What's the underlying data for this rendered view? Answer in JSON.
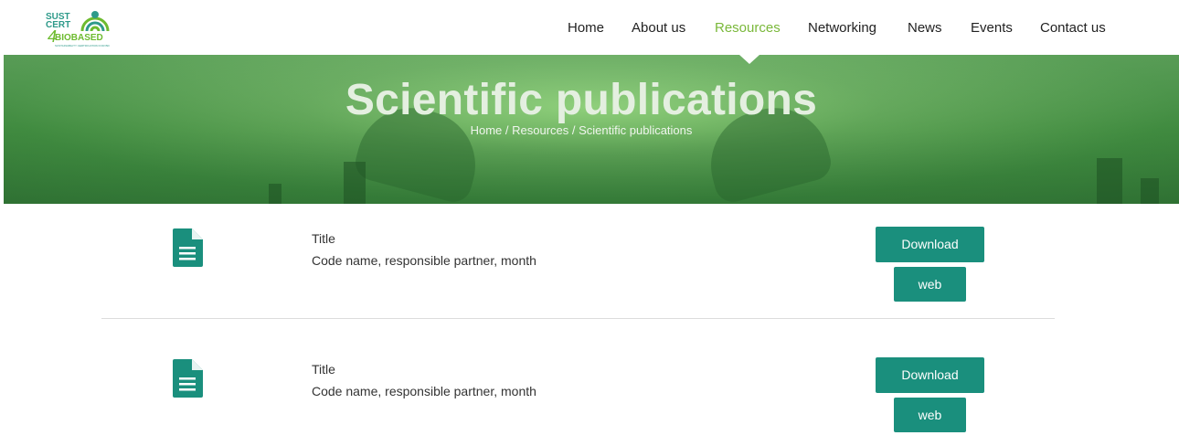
{
  "header": {
    "logo": {
      "line1": "SUST",
      "line2": "CERT",
      "numeral": "4",
      "line3": "BIOBASED",
      "tagline": "SUSTAINABILITY CERTIFICATION FOR BIOBASED SYSTEMS",
      "colors": {
        "teal": "#2e9a8a",
        "green": "#6dbb2f"
      }
    },
    "nav": [
      {
        "label": "Home",
        "active": false
      },
      {
        "label": "About us",
        "active": false
      },
      {
        "label": "Resources",
        "active": true
      },
      {
        "label": "Networking",
        "active": false
      },
      {
        "label": "News",
        "active": false
      },
      {
        "label": "Events",
        "active": false
      },
      {
        "label": "Contact us",
        "active": false
      }
    ],
    "active_color": "#7ab83a"
  },
  "hero": {
    "title": "Scientific publications",
    "breadcrumb": {
      "home": "Home",
      "sep1": " / ",
      "resources": "Resources",
      "sep2": " / ",
      "current": "Scientific publications"
    }
  },
  "publications": [
    {
      "icon": "document-icon",
      "title": "Title",
      "meta": "Code name, responsible partner, month",
      "download_label": "Download",
      "web_label": "web"
    },
    {
      "icon": "document-icon",
      "title": "Title",
      "meta": "Code name, responsible partner, month",
      "download_label": "Download",
      "web_label": "web"
    }
  ],
  "colors": {
    "button": "#1a8f7d",
    "hero_green": "#4f9a4a"
  }
}
